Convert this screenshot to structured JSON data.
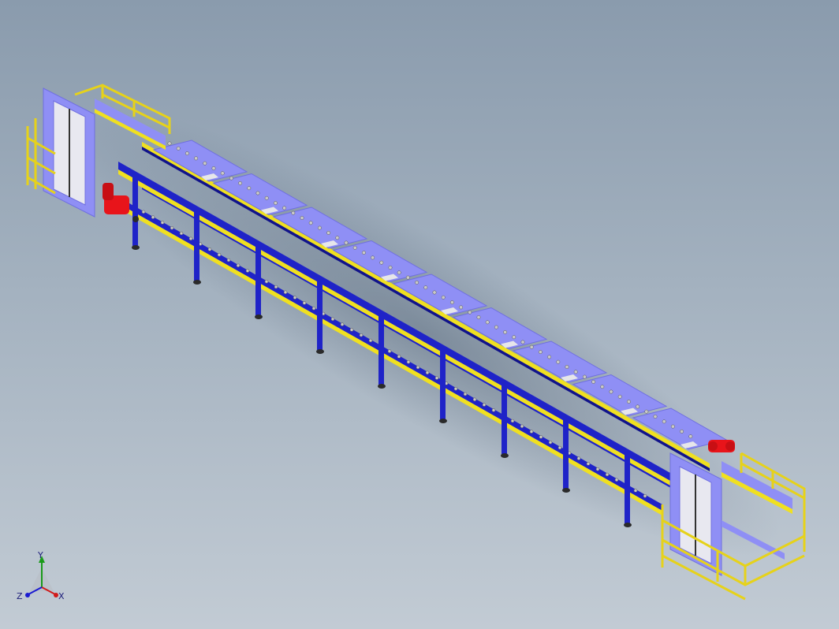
{
  "colors": {
    "background_top": "#8a9bad",
    "background_bottom": "#c2cbd4",
    "frame_blue": "#1f23c8",
    "frame_blue_dark": "#11138a",
    "rail_yellow": "#f0e020",
    "pallet_lavender": "#8f8ff5",
    "pallet_edge": "#6f6fe0",
    "motor_red": "#e8141a",
    "roller_grey": "#c9c9c9",
    "foot_dark": "#2a2a2a"
  },
  "scene": {
    "object": "pallet-conveyor-assembly",
    "pallet_count": 9,
    "lift_units": 2,
    "leg_count": 9
  },
  "triad": {
    "y_label": "Y",
    "x_label": "X",
    "z_label": "Z"
  }
}
